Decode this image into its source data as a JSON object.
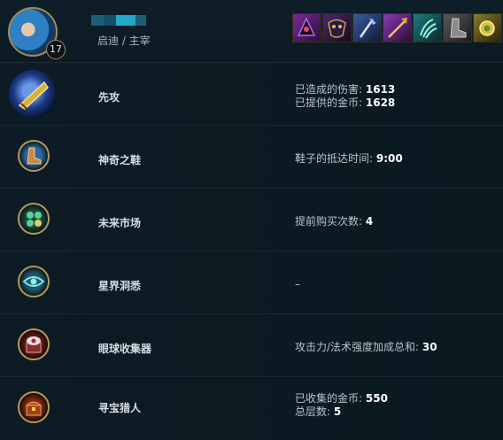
{
  "champion": {
    "level": "17",
    "name_colors": [
      "#1a5f78",
      "#22a9c8",
      "#1a5f78"
    ],
    "subtitle": "启迪 / 主宰"
  },
  "items": [
    {
      "icon": "hat-icon",
      "color": "#5a1e6e"
    },
    {
      "icon": "mask-icon",
      "color": "#3a2a6a"
    },
    {
      "icon": "staff-icon",
      "color": "#2e4a8a"
    },
    {
      "icon": "spear-icon",
      "color": "#6a2a8a"
    },
    {
      "icon": "claw-icon",
      "color": "#1e6a6a"
    },
    {
      "icon": "boots-icon",
      "color": "#3a3a3a"
    },
    {
      "icon": "amulet-icon",
      "color": "#6a5a1e"
    }
  ],
  "runes": [
    {
      "name": "先攻",
      "stats": [
        {
          "label": "已造成的伤害:",
          "value": "1613"
        },
        {
          "label": "已提供的金币:",
          "value": "1628"
        }
      ],
      "icon": "first-strike-icon"
    },
    {
      "name": "神奇之鞋",
      "stats": [
        {
          "label": "鞋子的抵达时间:",
          "value": "9:00"
        }
      ],
      "icon": "magical-footwear-icon"
    },
    {
      "name": "未来市场",
      "stats": [
        {
          "label": "提前购买次数:",
          "value": "4"
        }
      ],
      "icon": "future-market-icon"
    },
    {
      "name": "星界洞悉",
      "stats": [
        {
          "label": "–",
          "value": ""
        }
      ],
      "icon": "cosmic-insight-icon"
    },
    {
      "name": "眼球收集器",
      "stats": [
        {
          "label": "攻击力/法术强度加成总和:",
          "value": "30"
        }
      ],
      "icon": "eyeball-collection-icon"
    },
    {
      "name": "寻宝猎人",
      "stats": [
        {
          "label": "已收集的金币:",
          "value": "550"
        },
        {
          "label": "总层数:",
          "value": "5"
        }
      ],
      "icon": "treasure-hunter-icon"
    }
  ]
}
